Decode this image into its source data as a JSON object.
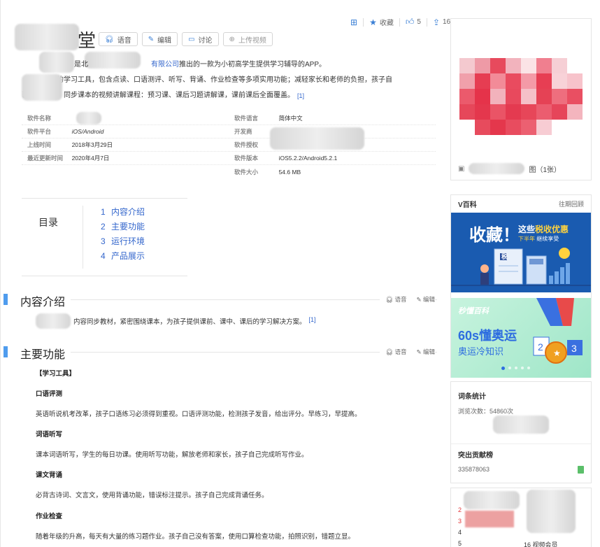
{
  "top_actions": {
    "favorite": "收藏",
    "like_count": "5",
    "share_count": "16"
  },
  "title": {
    "visible_tail": "堂"
  },
  "title_buttons": {
    "voice": "语音",
    "edit": "编辑",
    "discuss": "讨论",
    "upload_video": "上传视频"
  },
  "summary": {
    "line1_a": "是北",
    "line1_link": "有限公司",
    "line1_b": "推出的一款为小初高学生提供学习辅导的APP。",
    "line2": "提供的学习工具，包含点读、口语测评、听写、背诵、作业检查等多项实用功能；减轻家长和老师的负担，孩子自",
    "line3": "已完成学习；同步课本的视频讲解课程：预习课、课后习题讲解课，课前课后全面覆盖。",
    "ref": "[1]"
  },
  "info_table": [
    {
      "k1": "软件名称",
      "v1": "",
      "k2": "软件语言",
      "v2": "简体中文"
    },
    {
      "k1": "软件平台",
      "v1": "iOS/Android",
      "k2": "开发商",
      "v2": ""
    },
    {
      "k1": "上线时间",
      "v1": "2018年3月29日",
      "k2": "软件授权",
      "v2": ""
    },
    {
      "k1": "最近更新时间",
      "v1": "2020年4月7日",
      "k2": "软件版本",
      "v2": "iOS5.2.2/Android5.2.1"
    },
    {
      "k1": "",
      "v1": "",
      "k2": "软件大小",
      "v2": "54.6 MB"
    }
  ],
  "toc": {
    "title": "目录",
    "items": [
      {
        "num": "1",
        "label": "内容介绍"
      },
      {
        "num": "2",
        "label": "主要功能"
      },
      {
        "num": "3",
        "label": "运行环境"
      },
      {
        "num": "4",
        "label": "产品展示"
      }
    ]
  },
  "section_actions": {
    "voice": "语音",
    "edit": "编辑"
  },
  "sections": {
    "intro": {
      "title": "内容介绍",
      "text": "内容同步教材，紧密围绕课本，为孩子提供课前、课中、课后的学习解决方案。",
      "ref": "[1]"
    },
    "features": {
      "title": "主要功能",
      "group": "【学习工具】",
      "items": [
        {
          "h": "口语评测",
          "t": "英语听说机考改革，孩子口语练习必须得到重视。口语评测功能，检测孩子发音，给出评分。早练习，早提高。"
        },
        {
          "h": "词语听写",
          "t": "课本词语听写，学生的每日功课。使用听写功能，解放老师和家长，孩子自己完成听写作业。"
        },
        {
          "h": "课文背诵",
          "t": "必背古诗词、文言文，使用背诵功能，错误标注提示。孩子自己完成背诵任务。"
        },
        {
          "h": "作业检查",
          "t": "随着年级的升高，每天有大量的练习题作业。孩子自己没有答案，使用口算检查功能，拍照识别，错题立显。"
        }
      ]
    }
  },
  "album": {
    "caption": "图（1张）"
  },
  "vbaike": {
    "title": "V百科",
    "more": "往期回顾",
    "ad1": {
      "big": "收藏！",
      "line1_a": "这些",
      "line1_b": "税收优惠",
      "line2_a": "下半年",
      "line2_b": "继续享受",
      "tax_label": "税"
    },
    "ad2": {
      "logo": "秒懂百科",
      "big": "60s懂奥运",
      "sub": "奥运冷知识"
    }
  },
  "stats": {
    "title": "词条统计",
    "views": "浏览次数：54860次",
    "contrib_title": "突出贡献榜",
    "contrib_id": "335878063"
  },
  "rank": {
    "nums": [
      "2",
      "3",
      "4",
      "5"
    ],
    "tail": "16 视频会员"
  },
  "colors": {
    "accent_blue": "#4f9cee",
    "link": "#3366cc",
    "vbaike_ad1_bg": "#1a5bb0",
    "vbaike_ad2_text": "#2d6de0",
    "rank_red": "#e4393c"
  }
}
